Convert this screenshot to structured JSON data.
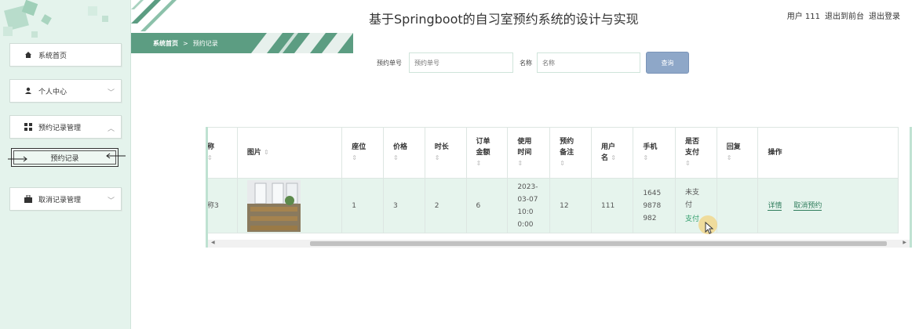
{
  "header": {
    "title": "基于Springboot的自习室预约系统的设计与实现",
    "user_label": "用户 111",
    "to_front": "退出到前台",
    "logout": "退出登录"
  },
  "sidebar": {
    "items": [
      {
        "label": "系统首页",
        "icon": "home-icon",
        "has_chevron": false
      },
      {
        "label": "个人中心",
        "icon": "user-icon",
        "has_chevron": true
      },
      {
        "label": "预约记录管理",
        "icon": "grid-icon",
        "has_chevron": true,
        "expanded": true
      },
      {
        "label": "取消记录管理",
        "icon": "briefcase-icon",
        "has_chevron": true
      }
    ],
    "sub_item": "预约记录"
  },
  "breadcrumb": {
    "home": "系统首页",
    "sep": ">",
    "current": "预约记录"
  },
  "search": {
    "order_label": "预约单号",
    "order_placeholder": "预约单号",
    "name_label": "名称",
    "name_placeholder": "名称",
    "button": "查询"
  },
  "table": {
    "headers": {
      "name": "称",
      "image": "图片",
      "seat": "座位",
      "price": "价格",
      "duration": "时长",
      "order_amount": "订单\n金额",
      "use_time": "使用\n时间",
      "remark": "预约\n备注",
      "username": "用户\n名",
      "phone": "手机",
      "paid": "是否\n支付",
      "reply": "回复",
      "ops": "操作"
    },
    "rows": [
      {
        "name": "称3",
        "seat": "1",
        "price": "3",
        "duration": "2",
        "order_amount": "6",
        "use_time": "2023-\n03-07\n10:0\n0:00",
        "remark": "12",
        "username": "111",
        "phone": "1645\n9878\n982",
        "paid": "未支\n付",
        "pay_action": "支付",
        "reply": "",
        "detail": "详情",
        "cancel": "取消预约"
      }
    ]
  },
  "colors": {
    "accent": "#5c9d82",
    "sidebar_bg": "#e4f3ec",
    "row_bg": "#e6f4ed",
    "button": "#8ea7c8"
  }
}
